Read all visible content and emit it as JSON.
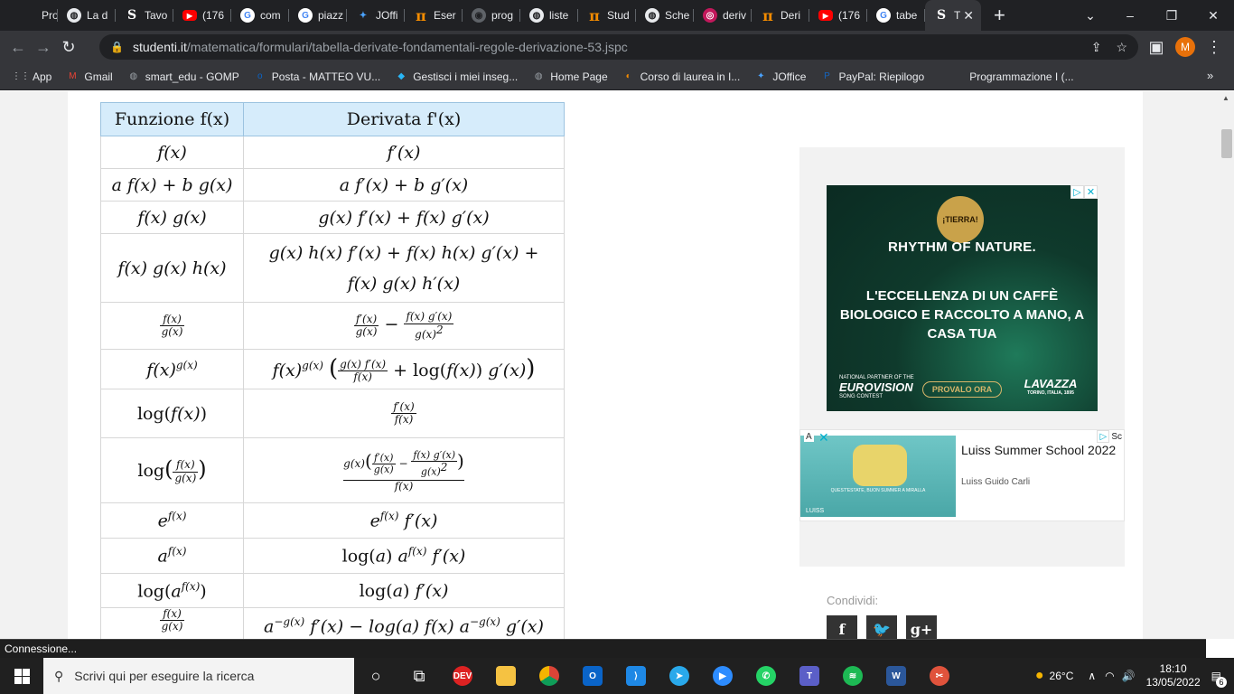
{
  "browser": {
    "tabs": [
      {
        "label": "Prov",
        "icon": "yt"
      },
      {
        "label": "La d",
        "icon": "globe"
      },
      {
        "label": "Tavo",
        "icon": "st"
      },
      {
        "label": "(176",
        "icon": "yt"
      },
      {
        "label": "com",
        "icon": "g"
      },
      {
        "label": "piazz",
        "icon": "g"
      },
      {
        "label": "JOffi",
        "icon": "jo"
      },
      {
        "label": "Eser",
        "icon": "pi"
      },
      {
        "label": "prog",
        "icon": "gh"
      },
      {
        "label": "liste",
        "icon": "globe"
      },
      {
        "label": "Stud",
        "icon": "pi"
      },
      {
        "label": "Sche",
        "icon": "globe"
      },
      {
        "label": "deriv",
        "icon": "red"
      },
      {
        "label": "Deri",
        "icon": "pi"
      },
      {
        "label": "(176",
        "icon": "yt"
      },
      {
        "label": "tabe",
        "icon": "g"
      }
    ],
    "active_tab_label": "T",
    "url_domain": "studenti.it",
    "url_path": "/matematica/formulari/tabella-derivate-fondamentali-regole-derivazione-53.jspc",
    "profile_initial": "M",
    "bookmarks": [
      {
        "label": "App",
        "icon": "grid"
      },
      {
        "label": "Gmail",
        "icon": "gmail"
      },
      {
        "label": "smart_edu - GOMP",
        "icon": "globe"
      },
      {
        "label": "Posta - MATTEO VU...",
        "icon": "outlook"
      },
      {
        "label": "Gestisci i miei inseg...",
        "icon": "diamond"
      },
      {
        "label": "Home Page",
        "icon": "globe"
      },
      {
        "label": "Corso di laurea in I...",
        "icon": "orange"
      },
      {
        "label": "JOffice",
        "icon": "jo"
      },
      {
        "label": "PayPal: Riepilogo",
        "icon": "paypal"
      },
      {
        "label": "Programmazione I (...",
        "icon": "none"
      }
    ]
  },
  "table": {
    "header_function": "Funzione f(x)",
    "header_derivative": "Derivata f'(x)"
  },
  "ads": {
    "ad1_badge": "¡TIERRA!",
    "ad1_title": "RHYTHM OF NATURE.",
    "ad1_body": "L'ECCELLENZA DI UN CAFFÈ BIOLOGICO E RACCOLTO A MANO, A CASA TUA",
    "ad1_partner": "NATIONAL PARTNER OF THE",
    "ad1_eurovision": "EUROVISION",
    "ad1_contest": "SONG CONTEST",
    "ad1_button": "PROVALO ORA",
    "ad1_brand": "LAVAZZA",
    "ad1_brand_sub": "TORINO, ITALIA, 1895",
    "ad2_title": "Luiss Summer School 2022",
    "ad2_sponsor": "Luiss Guido Carli",
    "ad2_img_caption": "QUEST'ESTATE, BUON SUMMER A MIRALLA",
    "ad2_img_brand": "LUISS",
    "ad2_corner_left": "A",
    "ad2_corner_right": "Sc"
  },
  "share": {
    "label": "Condividi:",
    "buttons": [
      "f",
      "t",
      "g+"
    ]
  },
  "status_text": "Connessione...",
  "taskbar": {
    "search_placeholder": "Scrivi qui per eseguire la ricerca",
    "weather": "26°C",
    "time": "18:10",
    "date": "13/05/2022",
    "notifications": "6"
  }
}
